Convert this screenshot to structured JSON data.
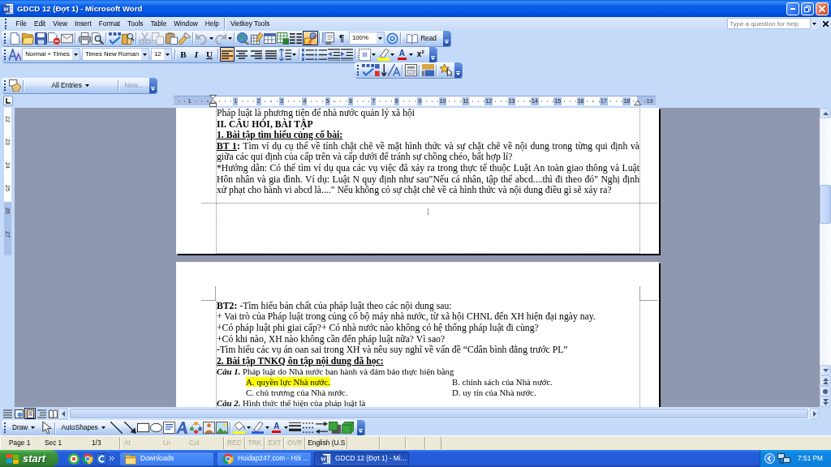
{
  "window": {
    "title": "GDCD 12 (Đợt 1) - Microsoft Word"
  },
  "menu": {
    "items": [
      "File",
      "Edit",
      "View",
      "Insert",
      "Format",
      "Tools",
      "Table",
      "Window",
      "Help"
    ],
    "addon": "Vietkey Tools",
    "help_box": {
      "placeholder": "Type a question for help"
    }
  },
  "standard_toolbar": {
    "drawing_toggle": {
      "on": true
    },
    "marks": "¶",
    "zoom": "100%",
    "read": "Read"
  },
  "formatting_toolbar": {
    "style": "Normal + Times",
    "font": "Times New Roman",
    "size": "12",
    "bold": "B",
    "italic": "I",
    "underline": "U",
    "alignment": [
      {
        "kind": "left",
        "on": true
      },
      {
        "kind": "center",
        "on": false
      },
      {
        "kind": "right",
        "on": false
      },
      {
        "kind": "justify",
        "on": false
      }
    ],
    "font_color": "A",
    "superscript": "x$^{2}$"
  },
  "autotext_toolbar": {
    "entries": "All Entries",
    "new_entry": {
      "label": "New...",
      "disabled": true
    }
  },
  "ruler": {
    "labels": [
      "1",
      "1",
      "2",
      "3",
      "4",
      "5",
      "6",
      "7",
      "8",
      "9",
      "10",
      "11",
      "12",
      "13",
      "14",
      "15",
      "16",
      "17",
      "18",
      "19"
    ]
  },
  "vertical_ruler": {
    "labels": [
      "22",
      "23",
      "24",
      "25",
      "26",
      "27"
    ]
  },
  "pages": [
    {
      "paragraphs": [
        {
          "kind": "body",
          "text": "Pháp luật là phương tiện để nhà nước quản lý xã hội"
        },
        {
          "kind": "heading",
          "text": "II. CÂU HỎI, BÀI TẬP"
        },
        {
          "kind": "subheading",
          "text": "1. Bài tập tìm hiểu củng cố bài:"
        },
        {
          "kind": "body",
          "lead": "BT 1",
          "text": "**:** Tìm ví dụ cụ thể về tính chặt chẽ về mặt hình thức và sự chặt chẽ về nội dung trong từng qui định và giữa các qui định của cấp trên và cấp dưới để tránh sự chồng chéo, bất hợp lí?"
        },
        {
          "kind": "body",
          "text": "*Hướng dẫn: Có thể tìm ví dụ qua các vụ việc đã xảy ra trong thực tế thuộc Luật An toàn giao thông và Luật Hôn nhân và gia đình. Ví dụ: Luật N quy định như sau\"Nếu cá nhân, tập thể abcd....thì đi theo đó\" Nghị định xử phạt cho hành vi abcd là....\" Nếu không có sự chặt chẽ về cả hình thức và nội dung điều gì sẽ xảy ra?"
        }
      ],
      "page_number": "1"
    },
    {
      "paragraphs": [
        {
          "kind": "body",
          "text": "**BT2:** -Tìm hiểu bản chất của pháp luật theo các nội dung sau:"
        },
        {
          "kind": "body",
          "text": "+ Vai trò của Pháp luật trong củng cố bộ máy nhà nước, từ xã hội CHNL đến XH hiện đại ngày nay."
        },
        {
          "kind": "body",
          "text": "+Có pháp luật phi giai cấp?+ Có nhà nước nào không có hệ thống pháp luật đi cùng?"
        },
        {
          "kind": "body",
          "text": "+Có khi nào, XH nào không cần đến pháp luật nữa? Vì sao?"
        },
        {
          "kind": "body",
          "text": "-Tìm hiểu các vụ án oan sai trong XH và nêu suy nghĩ về vấn đề “Cdân bình đẳng trước PL”"
        },
        {
          "kind": "subheading",
          "text": "2. Bài tập TNKQ ôn tập nội dung đã học:"
        },
        {
          "kind": "question",
          "text": "**Câu 1.** Pháp luật do Nhà nước ban hành và đảm bảo thực hiện bằng"
        },
        {
          "kind": "options",
          "options": [
            {
              "text": "A. quyền lực Nhà nước.",
              "highlighted": true
            },
            {
              "text": "B. chính sách của Nhà nước.",
              "highlighted": false
            }
          ]
        },
        {
          "kind": "options",
          "options": [
            {
              "text": "C. chủ trương của Nhà nước.",
              "highlighted": false
            },
            {
              "text": "D. uy tín của Nhà nước.",
              "highlighted": false
            }
          ]
        },
        {
          "kind": "question",
          "text": "**Câu 2.** Hình thức thể hiện của pháp luật là"
        }
      ]
    }
  ],
  "view_buttons": [
    {
      "kind": "normal",
      "selected": false
    },
    {
      "kind": "web",
      "selected": false
    },
    {
      "kind": "print",
      "selected": true
    },
    {
      "kind": "outline",
      "selected": false
    },
    {
      "kind": "reading",
      "selected": false
    }
  ],
  "drawing_toolbar": {
    "draw": "Draw",
    "autoshapes": "AutoShapes",
    "font_color": "A"
  },
  "status_bar": {
    "page": "Page 1",
    "section": "Sec 1",
    "count": "1/3",
    "position": [
      {
        "label": "At",
        "disabled": true
      },
      {
        "label": "Ln",
        "disabled": true
      },
      {
        "label": "Col",
        "disabled": true
      }
    ],
    "modes": [
      {
        "label": "REC",
        "on": false
      },
      {
        "label": "TRK",
        "on": false
      },
      {
        "label": "EXT",
        "on": false
      },
      {
        "label": "OVR",
        "on": false
      }
    ],
    "language": "English (U.S"
  },
  "taskbar": {
    "start": "start",
    "tasks": [
      {
        "kind": "folder",
        "label": "Downloads",
        "selected": false
      },
      {
        "kind": "browser",
        "label": "Hoidap247.com - Hỏi ...",
        "selected": false
      },
      {
        "kind": "word",
        "label": "GDCD 12 (Đợt 1) - Mi...",
        "selected": true
      }
    ],
    "clock": "7:51 PM"
  }
}
